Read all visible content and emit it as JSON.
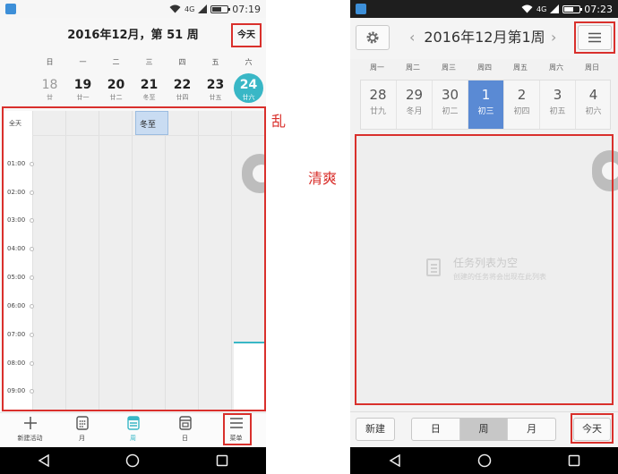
{
  "left": {
    "status": {
      "time": "07:19",
      "network": "4G"
    },
    "header": {
      "title": "2016年12月，第 51 周",
      "today_label": "今天"
    },
    "week_days": [
      "日",
      "一",
      "二",
      "三",
      "四",
      "五",
      "六"
    ],
    "dates": [
      {
        "day": "18",
        "sub": "廿"
      },
      {
        "day": "19",
        "sub": "廿一"
      },
      {
        "day": "20",
        "sub": "廿二"
      },
      {
        "day": "21",
        "sub": "冬至"
      },
      {
        "day": "22",
        "sub": "廿四"
      },
      {
        "day": "23",
        "sub": "廿五"
      },
      {
        "day": "24",
        "sub": "廿六"
      }
    ],
    "selected_index": 6,
    "all_day_label": "全天",
    "event_label": "冬至",
    "hours": [
      "01:00",
      "02:00",
      "03:00",
      "04:00",
      "05:00",
      "06:00",
      "07:00",
      "08:00",
      "09:00"
    ],
    "tabs": [
      {
        "label": "新建活动",
        "icon": "plus-icon"
      },
      {
        "label": "月",
        "icon": "month-grid-icon"
      },
      {
        "label": "周",
        "icon": "week-grid-icon"
      },
      {
        "label": "日",
        "icon": "day-icon"
      },
      {
        "label": "菜单",
        "icon": "menu-icon"
      }
    ],
    "active_tab": 2,
    "annotation": "乱"
  },
  "right": {
    "status": {
      "time": "07:23",
      "network": "4G"
    },
    "header": {
      "title": "2016年12月第1周"
    },
    "week_days": [
      "周一",
      "周二",
      "周三",
      "周四",
      "周五",
      "周六",
      "周日"
    ],
    "dates": [
      {
        "day": "28",
        "sub": "廿九"
      },
      {
        "day": "29",
        "sub": "冬月"
      },
      {
        "day": "30",
        "sub": "初二"
      },
      {
        "day": "1",
        "sub": "初三"
      },
      {
        "day": "2",
        "sub": "初四"
      },
      {
        "day": "3",
        "sub": "初五"
      },
      {
        "day": "4",
        "sub": "初六"
      }
    ],
    "selected_index": 3,
    "empty": {
      "title": "任务列表为空",
      "subtitle": "创建的任务将会出现在此列表"
    },
    "bottom": {
      "new_label": "新建",
      "views": [
        "日",
        "周",
        "月"
      ],
      "active_view": 1,
      "today_label": "今天"
    },
    "annotation": "清爽"
  },
  "colors": {
    "accent_teal": "#39b7c6",
    "accent_blue": "#5a8ad4",
    "annotation_red": "#d9302c"
  }
}
